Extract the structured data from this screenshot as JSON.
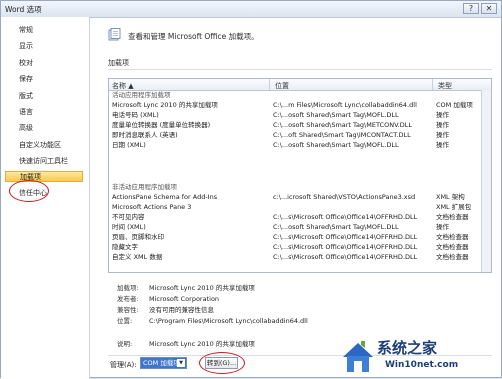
{
  "window": {
    "title": "Word 选项",
    "help_btn": "?",
    "close_btn": "✕"
  },
  "sidebar": {
    "items": [
      {
        "label": "常规"
      },
      {
        "label": "显示"
      },
      {
        "label": "校对"
      },
      {
        "label": "保存"
      },
      {
        "label": "版式"
      },
      {
        "label": "语言"
      },
      {
        "label": "高级"
      },
      {
        "label": "自定义功能区"
      },
      {
        "label": "快速访问工具栏"
      },
      {
        "label": "加载项"
      },
      {
        "label": "信任中心"
      }
    ],
    "active_index": 9
  },
  "header": {
    "title": "查看和管理 Microsoft Office 加载项。"
  },
  "section": {
    "title": "加载项"
  },
  "table": {
    "headers": {
      "name": "名称 ▲",
      "location": "位置",
      "type": "类型"
    },
    "rows": [
      {
        "group": true,
        "name": "活动应用程序加载项"
      },
      {
        "name": "Microsoft Lync 2010 的共享加载项",
        "location": "C:\\...m Files\\Microsoft Lync\\collabaddin64.dll",
        "type": "COM 加载项"
      },
      {
        "name": "电话号码 (XML)",
        "location": "C:\\...osoft Shared\\Smart Tag\\MOFL.DLL",
        "type": "操作"
      },
      {
        "name": "度量单位转换器 (度量单位转换器)",
        "location": "C:\\...osoft Shared\\Smart Tag\\METCONV.DLL",
        "type": "操作"
      },
      {
        "name": "即时消息联系人 (英语)",
        "location": "C:\\...oft Shared\\Smart Tag\\IMCONTACT.DLL",
        "type": "操作"
      },
      {
        "name": "日期 (XML)",
        "location": "C:\\...osoft Shared\\Smart Tag\\MOFL.DLL",
        "type": "操作"
      },
      {
        "group": true,
        "name": ""
      },
      {
        "group": true,
        "name": "非活动应用程序加载项"
      },
      {
        "name": "ActionsPane Schema for Add-Ins",
        "location": "c:\\...icrosoft Shared\\VSTO\\ActionsPane3.xsd",
        "type": "XML 架构"
      },
      {
        "name": "Microsoft Actions Pane 3",
        "location": "",
        "type": "XML 扩展包"
      },
      {
        "name": "不可见内容",
        "location": "C:\\...s\\Microsoft Office\\Office14\\OFFRHD.DLL",
        "type": "文档检查器"
      },
      {
        "name": "时间 (XML)",
        "location": "C:\\...osoft Shared\\Smart Tag\\MOFL.DLL",
        "type": "操作"
      },
      {
        "name": "页眉、页脚和水印",
        "location": "C:\\...s\\Microsoft Office\\Office14\\OFFRHD.DLL",
        "type": "文档检查器"
      },
      {
        "name": "隐藏文字",
        "location": "C:\\...s\\Microsoft Office\\Office14\\OFFRHD.DLL",
        "type": "文档检查器"
      },
      {
        "name": "自定义 XML 数据",
        "location": "C:\\...s\\Microsoft Office\\Office14\\OFFRHD.DLL",
        "type": "文档检查器"
      },
      {
        "name": "",
        "location": "",
        "type": ""
      }
    ]
  },
  "details": {
    "addin_label": "加载项:",
    "addin_value": "Microsoft Lync 2010 的共享加载项",
    "publisher_label": "发布者:",
    "publisher_value": "Microsoft Corporation",
    "compat_label": "兼容性:",
    "compat_value": "没有可用的兼容性信息",
    "location_label": "位置:",
    "location_value": "C:\\Program Files\\Microsoft Lync\\collabaddin64.dll",
    "desc_label": "说明:",
    "desc_value": "Microsoft Lync 2010 的共享加载项"
  },
  "footer": {
    "manage_label": "管理(A):",
    "manage_value": "COM 加载项",
    "goto_label": "转到(G)..."
  },
  "watermark": {
    "line1": "系统之家",
    "line2": "Win10net.com"
  }
}
